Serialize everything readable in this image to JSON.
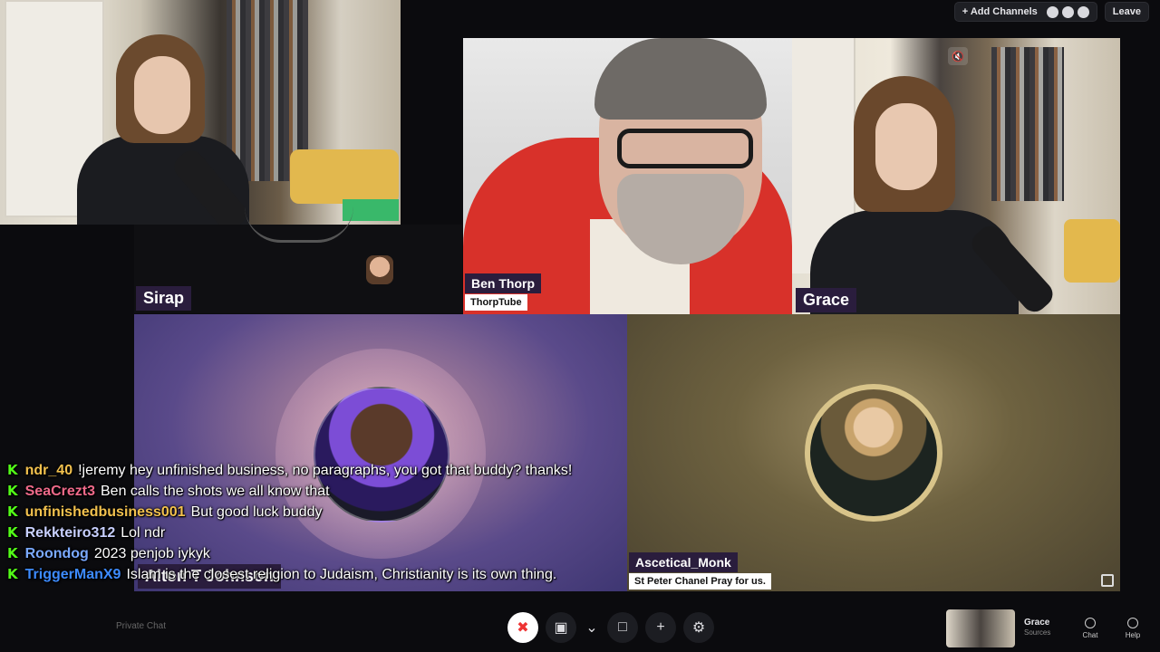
{
  "topbar": {
    "add_channels_label": "+ Add Channels",
    "leave_label": "Leave"
  },
  "participants": {
    "sirap": {
      "name": "Sirap"
    },
    "ben": {
      "name": "Ben Thorp",
      "subtitle": "ThorpTube"
    },
    "grace": {
      "name": "Grace"
    },
    "alton": {
      "name": "Alton T Johnson"
    },
    "monk": {
      "name": "Ascetical_Monk",
      "subtitle": "St Peter Chanel Pray for us."
    }
  },
  "chat": {
    "messages": [
      {
        "user": "ndr_40",
        "color": "#f2c14e",
        "text": "!jeremy hey unfinished business, no paragraphs, you got that buddy? thanks!"
      },
      {
        "user": "SeaCrezt3",
        "color": "#ef6a8a",
        "text": "Ben calls the shots we all know that"
      },
      {
        "user": "unfinishedbusiness001",
        "color": "#f2c14e",
        "text": "But good luck buddy"
      },
      {
        "user": "Rekkteiro312",
        "color": "#c8d0ff",
        "text": "Lol ndr"
      },
      {
        "user": "Roondog",
        "color": "#7aa9ff",
        "text": "2023 penjob iykyk"
      },
      {
        "user": "TriggerManX9",
        "color": "#3d8bff",
        "text": "Islam is the closest religion to Judaism, Christianity is its own thing."
      }
    ]
  },
  "bottom": {
    "private_chat_label": "Private Chat",
    "self_name": "Grace",
    "self_sources": "Sources",
    "chat_label": "Chat",
    "help_label": "Help"
  }
}
